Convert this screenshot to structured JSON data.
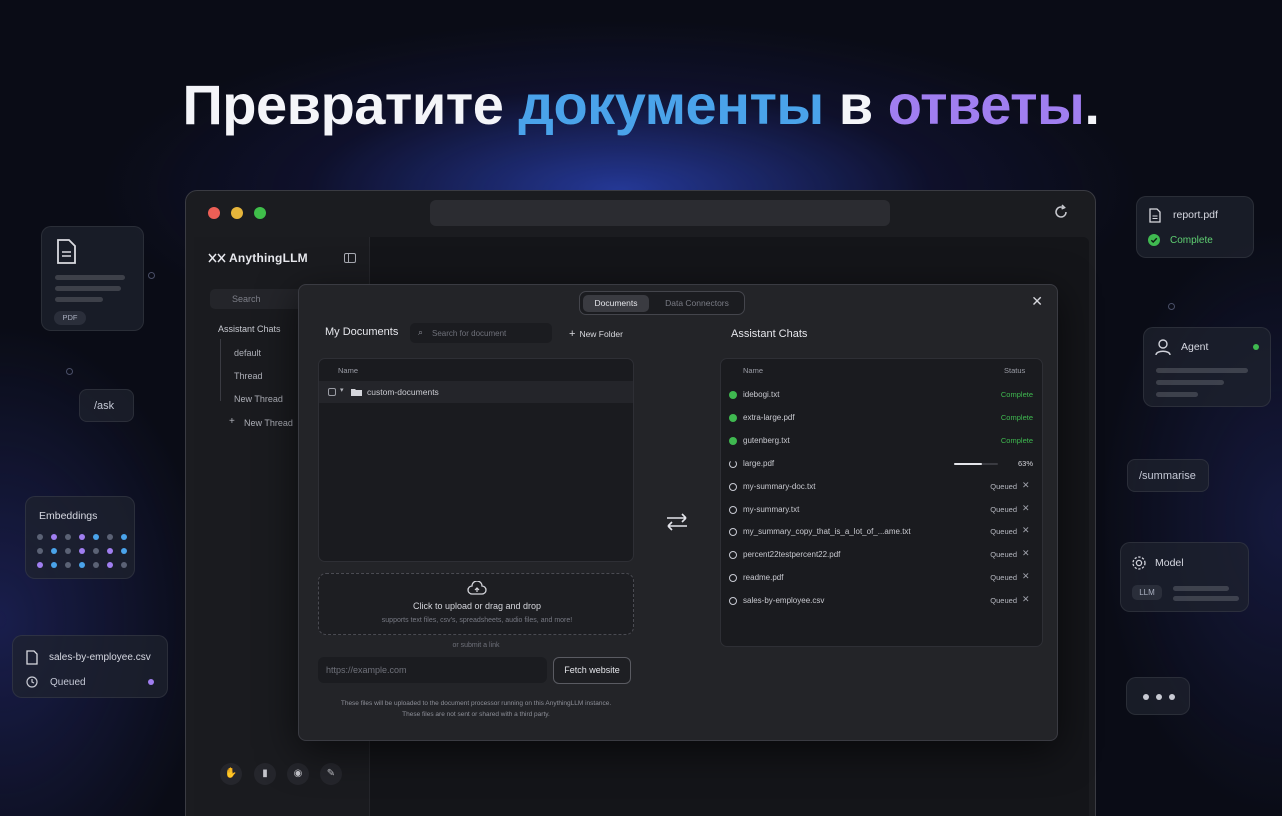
{
  "hero": {
    "part1": "Превратите ",
    "part2": "документы",
    "part3": " в ",
    "part4": "ответы",
    "part5": "."
  },
  "cards": {
    "pdf_badge": "PDF",
    "ask": "/ask",
    "embeddings": "Embeddings",
    "csv_file": "sales-by-employee.csv",
    "csv_status": "Queued",
    "report_file": "report.pdf",
    "report_status": "Complete",
    "agent": "Agent",
    "summarise": "/summarise",
    "model": "Model",
    "llm_badge": "LLM"
  },
  "app": {
    "logo": "AnythingLLM",
    "search_placeholder": "Search",
    "workspace": "Assistant Chats",
    "threads": [
      "default",
      "Thread",
      "New Thread"
    ],
    "new_thread": "New Thread"
  },
  "modal": {
    "tabs": [
      "Documents",
      "Data Connectors"
    ],
    "my_documents": "My Documents",
    "search_placeholder": "Search for document",
    "new_folder": "New Folder",
    "col_name": "Name",
    "folder_name": "custom-documents",
    "upload_title": "Click to upload or drag and drop",
    "upload_sub": "supports text files, csv's, spreadsheets, audio files, and more!",
    "or_link": "or submit a link",
    "url_placeholder": "https://example.com",
    "fetch_button": "Fetch website",
    "note_line1": "These files will be uploaded to the document processor running on this AnythingLLM instance.",
    "note_line2": "These files are not sent or shared with a third party.",
    "assistant_title": "Assistant Chats",
    "col_status": "Status",
    "chat_files": [
      {
        "name": "idebogi.txt",
        "status": "Complete",
        "state": "complete"
      },
      {
        "name": "extra-large.pdf",
        "status": "Complete",
        "state": "complete"
      },
      {
        "name": "gutenberg.txt",
        "status": "Complete",
        "state": "complete"
      },
      {
        "name": "large.pdf",
        "status": "63%",
        "state": "progress",
        "progress": 0.63
      },
      {
        "name": "my-summary-doc.txt",
        "status": "Queued",
        "state": "queued"
      },
      {
        "name": "my-summary.txt",
        "status": "Queued",
        "state": "queued"
      },
      {
        "name": "my_summary_copy_that_is_a_lot_of_...ame.txt",
        "status": "Queued",
        "state": "queued"
      },
      {
        "name": "percent22testpercent22.pdf",
        "status": "Queued",
        "state": "queued"
      },
      {
        "name": "readme.pdf",
        "status": "Queued",
        "state": "queued"
      },
      {
        "name": "sales-by-employee.csv",
        "status": "Queued",
        "state": "queued"
      }
    ]
  },
  "colors": {
    "accent_blue": "#4aa3ea",
    "accent_purple": "#a07ef0",
    "complete_green": "#3fb950"
  }
}
